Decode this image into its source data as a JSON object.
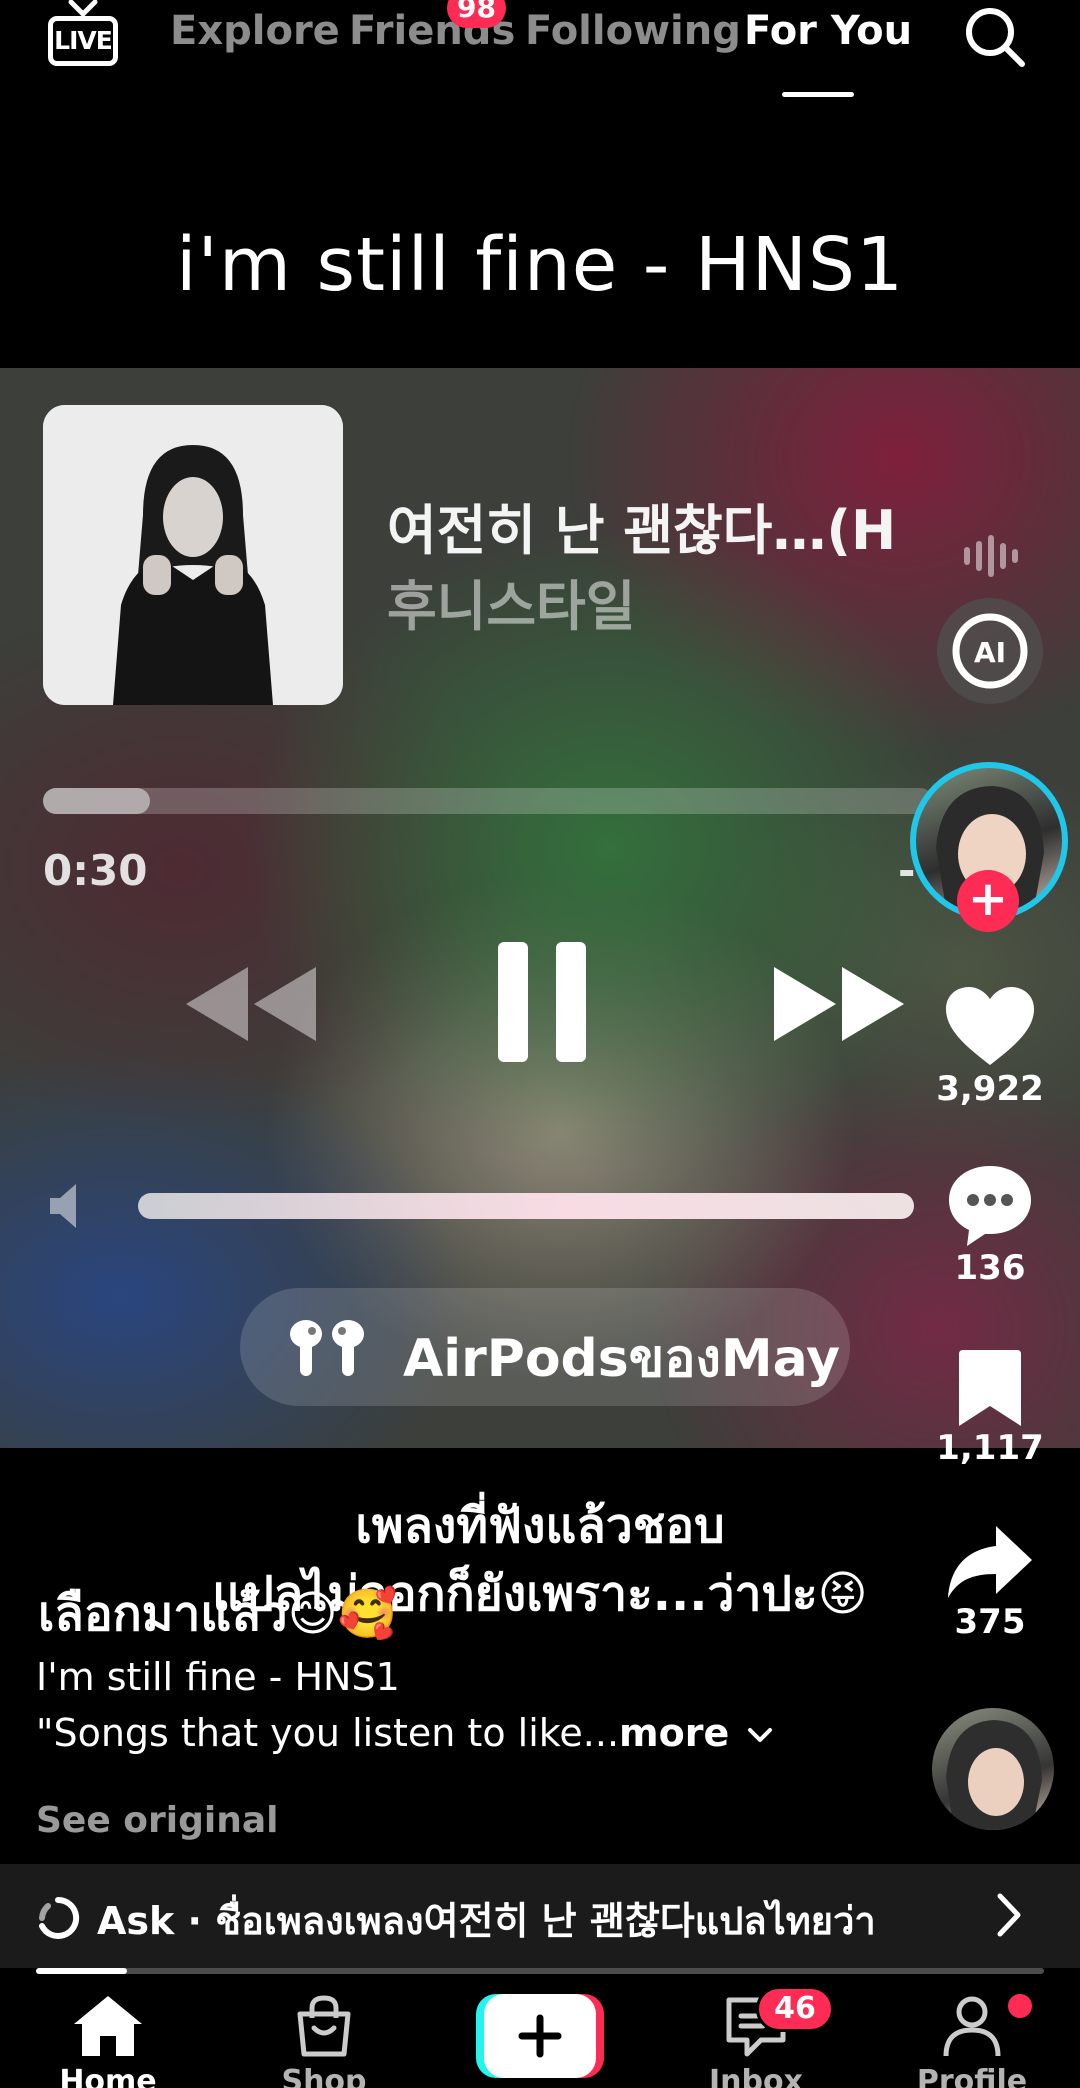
{
  "top_nav": {
    "live_label": "LIVE",
    "tabs": [
      {
        "label": "Explore",
        "active": false
      },
      {
        "label": "Friends",
        "active": false,
        "badge": "98"
      },
      {
        "label": "Following",
        "active": false
      },
      {
        "label": "For You",
        "active": true
      }
    ],
    "search_icon": "search-icon"
  },
  "video": {
    "title_overlay": "i'm still fine - HNS1",
    "player": {
      "song_title": "여전히 난 괜찮다…(H",
      "artist": "후니스타일",
      "elapsed": "0:30",
      "remaining": "-",
      "progress_fraction": 0.12,
      "device_label": "AirPodsของMay",
      "controls": [
        "rewind-icon",
        "pause-icon",
        "fast-forward-icon"
      ]
    },
    "overlay_caption": [
      "เพลงที่ฟังแล้วชอบ",
      "แปลไม่ออกก็ยังเพราะ...ว่าปะ😝"
    ],
    "caption_line1": "เลือกมาแล้ว😊🥰",
    "caption_sub": "I'm still fine - HNS1",
    "caption_desc": "\"Songs that you listen to like...",
    "caption_more": "more",
    "see_original": "See original",
    "playback_fraction": 0.09
  },
  "actions": {
    "likes": "3,922",
    "comments": "136",
    "saves": "1,117",
    "shares": "375"
  },
  "ask_bar": {
    "text": "Ask · ชื่อเพลงเพลง여전히 난 괜찮다แปลไทยว่า"
  },
  "bottom_nav": {
    "items": [
      {
        "label": "Home",
        "active": true
      },
      {
        "label": "Shop",
        "active": false
      },
      {
        "label": "Inbox",
        "active": false,
        "badge": "46"
      },
      {
        "label": "Profile",
        "active": false
      }
    ]
  },
  "colors": {
    "accent_red": "#fe2c55",
    "avatar_ring": "#20c7e8"
  }
}
